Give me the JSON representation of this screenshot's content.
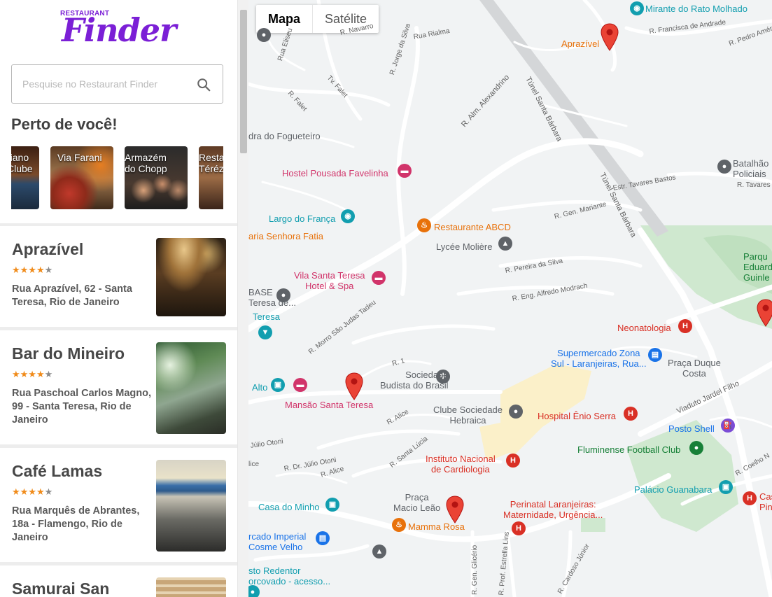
{
  "logo": {
    "small": "RESTAURANT",
    "big": "Finder"
  },
  "search": {
    "placeholder": "Pesquise no Restaurant Finder"
  },
  "nearby": {
    "title": "Perto de você!",
    "items": [
      {
        "label": "riano\nClube"
      },
      {
        "label": "Via Farani"
      },
      {
        "label": "Armazém\ndo Chopp"
      },
      {
        "label": "Resta\nTéréz"
      }
    ]
  },
  "restaurants": [
    {
      "name": "Aprazível",
      "rating": 4,
      "address": "Rua Aprazível, 62 - Santa Teresa, Rio de Janeiro"
    },
    {
      "name": "Bar do Mineiro",
      "rating": 4.5,
      "address": "Rua Paschoal Carlos Magno, 99 - Santa Teresa, Rio de Janeiro"
    },
    {
      "name": "Café Lamas",
      "rating": 4,
      "address": "Rua Marquês de Abrantes, 18a - Flamengo, Rio de Janeiro"
    },
    {
      "name": "Samurai San",
      "rating": 4,
      "address": ""
    }
  ],
  "map": {
    "type_buttons": {
      "map": "Mapa",
      "satellite": "Satélite"
    },
    "pois": {
      "mirante": "Mirante do Rato Molhado",
      "aprazivel": "Aprazível",
      "fogueteiro": "dra do Fogueteiro",
      "hostel": "Hostel Pousada Favelinha",
      "largo": "Largo do França",
      "abcd": "Restaurante ABCD",
      "senhora": "aria Senhora Fatia",
      "lycee": "Lycée Molière",
      "vila": "Vila Santa Teresa\nHotel & Spa",
      "base": "BASE\nTeresa de...",
      "teresa": "Teresa",
      "batalhao": "Batalhão\nPoliciais",
      "parque": "Parqu\nEduard\nGuinle",
      "neonatologia": "Neonatologia",
      "supermercado": "Supermercado Zona\nSul - Laranjeiras, Rua...",
      "praca_duque": "Praça Duque\nCosta",
      "sociedade": "Sociedade\nBudista do Brasil",
      "alto": "Alto",
      "mansao": "Mansão Santa Teresa",
      "clube": "Clube Sociedade\nHebraica",
      "hospital": "Hospital Ênio Serra",
      "posto": "Posto Shell",
      "fluminense": "Fluminense Football Club",
      "instituto": "Instituto Nacional\nde Cardiologia",
      "palacio": "Palácio Guanabara",
      "cas": "Cas\nPin",
      "casa_minho": "Casa do Minho",
      "praca_macio": "Praça\nMacio Leão",
      "mamma": "Mamma Rosa",
      "perinatal": "Perinatal Laranjeiras:\nMaternidade, Urgência...",
      "imperial": "rcado Imperial\nCosme Velho",
      "redentor": "sto Redentor\norcovado - acesso..."
    },
    "streets": {
      "navarro": "R. Navarro",
      "rialma": "Rua Rialma",
      "jorge": "R. Jorge da Silva",
      "eliseu": "Rua Eliseu",
      "falet": "R. Falet",
      "tv_falet": "Tv. Falet",
      "alexandrino": "R. Alm. Alexandrino",
      "tunel": "Túnel Santa Bárbara",
      "tunel2": "Túnel Santa Bárbara",
      "francisca": "R. Francisca de Andrade",
      "pedro": "R. Pedro Amér",
      "tavares": "Estr. Tavares Bastos",
      "tavares2": "R. Tavares B",
      "mariante": "R. Gen. Mariante",
      "pereira": "R. Pereira da Silva",
      "modrach": "R. Eng. Alfredo Modrach",
      "morro": "R. Morro São Judas Tadeu",
      "r1": "R. 1",
      "alice": "R. Alice",
      "alice2": "R. Alice",
      "viaduto": "Viaduto Jardel Filho",
      "julio": "Júlio Otoni",
      "julio2": "R. Dr. Júlio Otoni",
      "santa_lucia": "R. Santa Lúcia",
      "glicerio": "R. Gen. Glicério",
      "estrella": "R. Prof. Estrella Lins",
      "cardoso": "R. Cardoso Júnior",
      "coelho": "R. Coelho N",
      "ice": "lice"
    }
  },
  "colors": {
    "brand": "#7b1fd6",
    "star": "#f08b1a",
    "map_bg": "#f1f3f4",
    "park": "#c8e6c9",
    "pin": "#ea4335"
  }
}
